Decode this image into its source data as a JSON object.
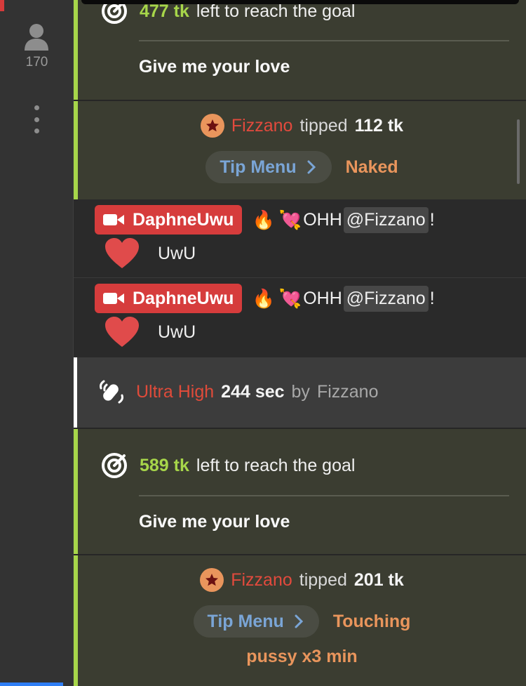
{
  "sidebar": {
    "viewer_icon": "user-icon",
    "viewer_count": "170",
    "more_icon": "more-vertical-icon"
  },
  "goal_top": {
    "tokens": "477 tk",
    "text": "left to reach the goal",
    "title": "Give me your love"
  },
  "tip_1": {
    "user": "Fizzano",
    "verb": "tipped",
    "amount": "112 tk",
    "menu_label": "Tip Menu",
    "item": "Naked"
  },
  "chat": [
    {
      "user": "DaphneUwu",
      "emoji_1": "🔥",
      "emoji_2": "💘",
      "text": "OHH",
      "mention": "@Fizzano",
      "suffix": "!",
      "line2": "UwU"
    },
    {
      "user": "DaphneUwu",
      "emoji_1": "🔥",
      "emoji_2": "💘",
      "text": "OHH",
      "mention": "@Fizzano",
      "suffix": "!",
      "line2": "UwU"
    }
  ],
  "vibe": {
    "level": "Ultra High",
    "duration": "244 sec",
    "by": "by",
    "user": "Fizzano"
  },
  "goal_bottom": {
    "tokens": "589 tk",
    "text": "left to reach the goal",
    "title": "Give me your love"
  },
  "tip_2": {
    "user": "Fizzano",
    "verb": "tipped",
    "amount": "201 tk",
    "menu_label": "Tip Menu",
    "item_line1": "Touching",
    "item_line2": "pussy x3 min"
  },
  "colors": {
    "goal_accent": "#a7d64a",
    "tipper_name": "#e24a3d",
    "tip_menu_text": "#7aa5d6",
    "menu_item": "#e9955c",
    "badge_red": "#d63c3c",
    "vibe_level": "#e04b3a"
  }
}
